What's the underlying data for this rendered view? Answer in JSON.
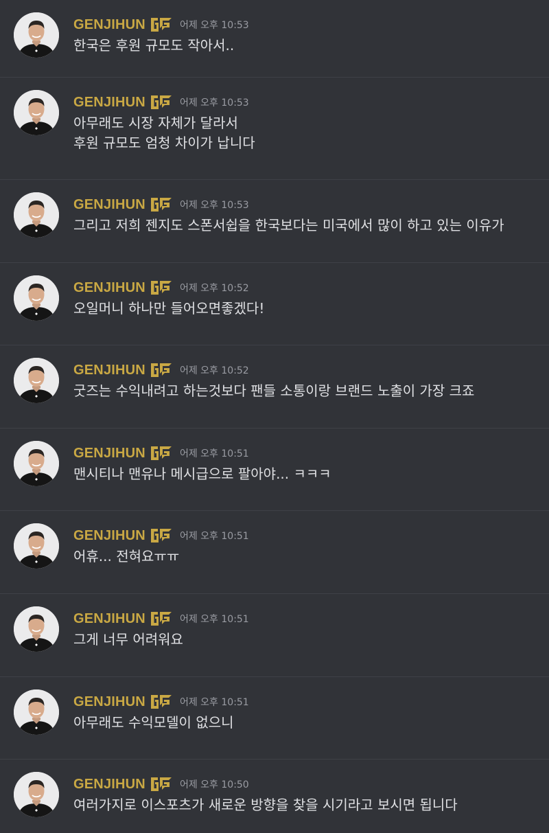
{
  "messages": [
    {
      "author": "GENJIHUN",
      "timestamp": "어제 오후 10:53",
      "lines": [
        "한국은 후원 규모도 작아서.."
      ]
    },
    {
      "author": "GENJIHUN",
      "timestamp": "어제 오후 10:53",
      "lines": [
        "아무래도 시장 자체가 달라서",
        "후원 규모도 엄청 차이가 납니다"
      ]
    },
    {
      "author": "GENJIHUN",
      "timestamp": "어제 오후 10:53",
      "lines": [
        "그리고 저희 젠지도 스폰서쉽을 한국보다는 미국에서 많이 하고 있는 이유가"
      ]
    },
    {
      "author": "GENJIHUN",
      "timestamp": "어제 오후 10:52",
      "lines": [
        "오일머니 하나만 들어오면좋겠다!"
      ]
    },
    {
      "author": "GENJIHUN",
      "timestamp": "어제 오후 10:52",
      "lines": [
        "굿즈는 수익내려고 하는것보다 팬들 소통이랑 브랜드 노출이 가장 크죠"
      ]
    },
    {
      "author": "GENJIHUN",
      "timestamp": "어제 오후 10:51",
      "lines": [
        "맨시티나 맨유나 메시급으로 팔아야... ㅋㅋㅋ"
      ]
    },
    {
      "author": "GENJIHUN",
      "timestamp": "어제 오후 10:51",
      "lines": [
        "어휴... 전혀요ㅠㅠ"
      ]
    },
    {
      "author": "GENJIHUN",
      "timestamp": "어제 오후 10:51",
      "lines": [
        "그게 너무 어려워요"
      ]
    },
    {
      "author": "GENJIHUN",
      "timestamp": "어제 오후 10:51",
      "lines": [
        "아무래도 수익모델이 없으니"
      ]
    },
    {
      "author": "GENJIHUN",
      "timestamp": "어제 오후 10:50",
      "lines": [
        "여러가지로 이스포츠가 새로운 방향을 찾을 시기라고 보시면 됩니다"
      ]
    }
  ],
  "colors": {
    "background": "#313338",
    "divider": "#3f4147",
    "username": "#c9a844",
    "timestamp": "#9a9ca3",
    "message_text": "#dfe0e3"
  },
  "icons": {
    "badge": "gen-g-logo-icon",
    "avatar": "user-avatar"
  }
}
